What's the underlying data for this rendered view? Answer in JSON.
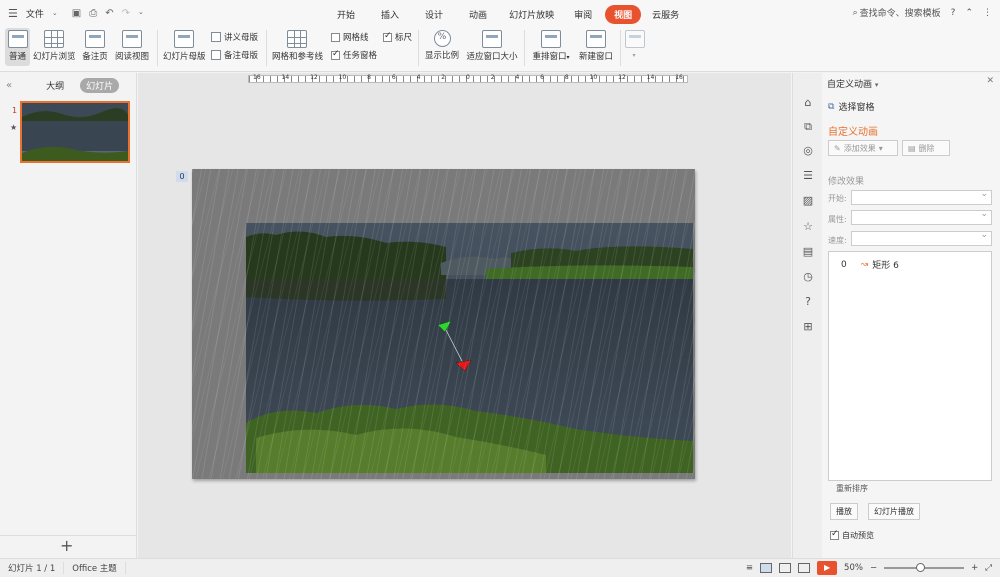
{
  "menubar": {
    "file_label": "文件",
    "tabs": [
      {
        "label": "开始"
      },
      {
        "label": "插入"
      },
      {
        "label": "设计"
      },
      {
        "label": "动画"
      },
      {
        "label": "幻灯片放映"
      },
      {
        "label": "审阅"
      },
      {
        "label": "视图",
        "active": true
      },
      {
        "label": "云服务"
      }
    ],
    "search_placeholder": "查找命令、搜索模板",
    "help_label": "?"
  },
  "ribbon": {
    "normal": "普通",
    "slide_sorter": "幻灯片浏览",
    "notes_page": "备注页",
    "reading_view": "阅读视图",
    "slide_master": "幻灯片母版",
    "handout_master": "讲义母版",
    "notes_master": "备注母版",
    "grid_guides": "网格和参考线",
    "gridlines": "网格线",
    "ruler": "标尺",
    "task_pane": "任务窗格",
    "zoom": "显示比例",
    "fit_window": "适应窗口大小",
    "arrange": "重排窗口",
    "new_window": "新建窗口",
    "checkbox_state": {
      "gridlines": false,
      "ruler": true,
      "task_pane": true
    }
  },
  "left_panel": {
    "tab_outline": "大纲",
    "tab_slides": "幻灯片",
    "slide_number": "1",
    "add_label": "+"
  },
  "editor": {
    "ruler_labels": [
      "16",
      "14",
      "12",
      "10",
      "8",
      "6",
      "4",
      "2",
      "0",
      "2",
      "4",
      "6",
      "8",
      "10",
      "12",
      "14",
      "16"
    ],
    "animation_tag": "0"
  },
  "task_pane": {
    "title": "自定义动画",
    "select_pane": "选择窗格",
    "heading": "自定义动画",
    "add_effect": "添加效果",
    "delete": "删除",
    "modify": "修改效果",
    "start_label": "开始:",
    "property_label": "属性:",
    "speed_label": "速度:",
    "list_item": {
      "index": "0",
      "name": "矩形 6"
    },
    "reorder": "重新排序",
    "play_button": "播放",
    "slideshow_button": "幻灯片播放",
    "autopreview": "自动预览"
  },
  "statusbar": {
    "slide_info": "幻灯片 1 / 1",
    "theme": "Office 主题",
    "zoom_value": "50%",
    "minus": "−",
    "plus": "+"
  },
  "colors": {
    "accent": "#e8522e",
    "active_tab": "#e8522e"
  },
  "icons": {
    "menu": "hamburger-icon",
    "search": "search-icon",
    "play": "play-icon"
  }
}
